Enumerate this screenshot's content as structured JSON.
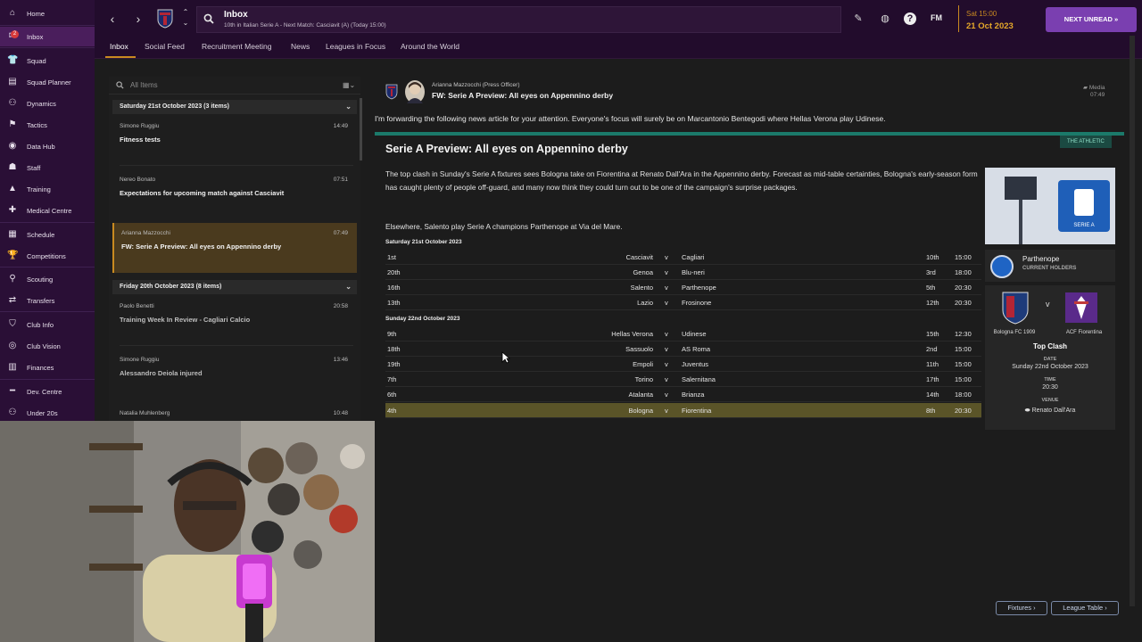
{
  "sidebar": {
    "items": [
      {
        "label": "Home",
        "icon": "home-icon"
      },
      {
        "label": "Inbox",
        "icon": "inbox-icon",
        "badge": "2"
      },
      {
        "label": "Squad",
        "icon": "shirt-icon"
      },
      {
        "label": "Squad Planner",
        "icon": "planner-icon"
      },
      {
        "label": "Dynamics",
        "icon": "dynamics-icon"
      },
      {
        "label": "Tactics",
        "icon": "tactics-icon"
      },
      {
        "label": "Data Hub",
        "icon": "data-hub-icon"
      },
      {
        "label": "Staff",
        "icon": "staff-icon"
      },
      {
        "label": "Training",
        "icon": "training-icon"
      },
      {
        "label": "Medical Centre",
        "icon": "medical-icon"
      },
      {
        "label": "Schedule",
        "icon": "calendar-icon"
      },
      {
        "label": "Competitions",
        "icon": "trophy-icon"
      },
      {
        "label": "Scouting",
        "icon": "scouting-icon"
      },
      {
        "label": "Transfers",
        "icon": "transfers-icon"
      },
      {
        "label": "Club Info",
        "icon": "club-info-icon"
      },
      {
        "label": "Club Vision",
        "icon": "club-vision-icon"
      },
      {
        "label": "Finances",
        "icon": "finances-icon"
      },
      {
        "label": "Dev. Centre",
        "icon": "dev-centre-icon"
      },
      {
        "label": "Under 20s",
        "icon": "under-20s-icon"
      }
    ]
  },
  "header": {
    "title": "Inbox",
    "subtitle": "10th in Italian Serie A - Next Match: Casciavit (A) (Today 15:00)",
    "fm_logo": "FM",
    "date_time": "Sat 15:00",
    "date": "21 Oct 2023",
    "next_unread": "NEXT UNREAD"
  },
  "tabs": [
    "Inbox",
    "Social Feed",
    "Recruitment Meeting",
    "News",
    "Leagues in Focus",
    "Around the World"
  ],
  "inbox": {
    "filter_placeholder": "All Items",
    "groups": [
      {
        "label": "Saturday 21st October 2023 (3 items)"
      },
      {
        "label": "Friday 20th October 2023 (8 items)"
      }
    ],
    "messages": [
      {
        "from": "Simone Ruggiu",
        "time": "14:49",
        "subject": "Fitness tests"
      },
      {
        "from": "Nereo Bonato",
        "time": "07:51",
        "subject": "Expectations for upcoming match against Casciavit"
      },
      {
        "from": "Arianna Mazzocchi",
        "time": "07:49",
        "subject": "FW: Serie A Preview: All eyes on Appennino derby"
      },
      {
        "from": "Paolo Benetti",
        "time": "20:58",
        "subject": "Training Week In Review - Cagliari Calcio"
      },
      {
        "from": "Simone Ruggiu",
        "time": "13:46",
        "subject": "Alessandro Deiola injured"
      },
      {
        "from": "Natalia Muhlenberg",
        "time": "10:48",
        "subject": ""
      }
    ]
  },
  "reader": {
    "sender": "Arianna Mazzocchi  (Press Officer)",
    "subject": "FW: Serie A Preview: All eyes on Appennino derby",
    "media_tag": "Media",
    "time": "07:49",
    "intro": "I'm forwarding the following news article for your attention. Everyone's focus will surely be on Marcantonio Bentegodi where Hellas Verona play Udinese.",
    "source_tag": "THE ATHLETIC",
    "article_title": "Serie A Preview: All eyes on Appennino derby",
    "p1": "The top clash in Sunday's Serie A fixtures sees Bologna take on Fiorentina at Renato Dall'Ara in the Appennino derby. Forecast as mid-table certainties, Bologna's early-season form has caught plenty of people off-guard, and many now think they could turn out to be one of the campaign's surprise packages.",
    "p2": "Elsewhere, Salento play Serie A champions Parthenope at Via del Mare.",
    "days": [
      {
        "label": "Saturday 21st October 2023",
        "fixtures": [
          {
            "hp": "1st",
            "home": "Casciavit",
            "away": "Cagliari",
            "ap": "10th",
            "time": "15:00"
          },
          {
            "hp": "20th",
            "home": "Genoa",
            "away": "Blu-neri",
            "ap": "3rd",
            "time": "18:00"
          },
          {
            "hp": "16th",
            "home": "Salento",
            "away": "Parthenope",
            "ap": "5th",
            "time": "20:30"
          },
          {
            "hp": "13th",
            "home": "Lazio",
            "away": "Frosinone",
            "ap": "12th",
            "time": "20:30"
          }
        ]
      },
      {
        "label": "Sunday 22nd October 2023",
        "fixtures": [
          {
            "hp": "9th",
            "home": "Hellas Verona",
            "away": "Udinese",
            "ap": "15th",
            "time": "12:30"
          },
          {
            "hp": "18th",
            "home": "Sassuolo",
            "away": "AS Roma",
            "ap": "2nd",
            "time": "15:00"
          },
          {
            "hp": "19th",
            "home": "Empoli",
            "away": "Juventus",
            "ap": "11th",
            "time": "15:00"
          },
          {
            "hp": "7th",
            "home": "Torino",
            "away": "Salernitana",
            "ap": "17th",
            "time": "15:00"
          },
          {
            "hp": "6th",
            "home": "Atalanta",
            "away": "Brianza",
            "ap": "14th",
            "time": "18:00"
          },
          {
            "hp": "4th",
            "home": "Bologna",
            "away": "Fiorentina",
            "ap": "8th",
            "time": "20:30"
          }
        ]
      }
    ],
    "vs": "v",
    "side": {
      "holders_name": "Parthenope",
      "holders_label": "CURRENT HOLDERS",
      "home_team": "Bologna FC 1909",
      "away_team": "ACF Fiorentina",
      "clash_v": "v",
      "clash_title": "Top Clash",
      "date_label": "DATE",
      "date_value": "Sunday 22nd October 2023",
      "time_label": "TIME",
      "time_value": "20:30",
      "venue_label": "VENUE",
      "venue_value": "Renato Dall'Ara",
      "competition_logo_text": "SERIE A"
    },
    "btn_fixtures": "Fixtures ›",
    "btn_league": "League Table ›"
  },
  "colors": {
    "sidebar": "#2a0f36",
    "accent_gold": "#c98a20",
    "next_unread": "#7a3fb0",
    "athletic_green": "#1b7a6a"
  }
}
